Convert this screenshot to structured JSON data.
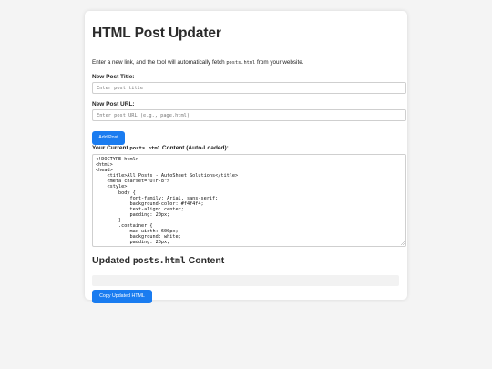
{
  "page": {
    "title": "HTML Post Updater",
    "intro_before": "Enter a new link, and the tool will automatically fetch ",
    "intro_code": "posts.html",
    "intro_after": " from your website."
  },
  "form": {
    "title_label": "New Post Title:",
    "title_placeholder": "Enter post title",
    "url_label": "New Post URL:",
    "url_placeholder": "Enter post URL (e.g., page.html)",
    "add_button": "Add Post"
  },
  "current": {
    "label_before": "Your Current ",
    "label_code": "posts.html",
    "label_after": " Content (Auto-Loaded):",
    "lines": [
      "<!DOCTYPE html>",
      "<html>",
      "<head>",
      "    <title>All Posts - AutoSheet Solutions</title>",
      "    <meta charset=\"UTF-8\">",
      "    <style>",
      "        body {",
      "            font-family: Arial, sans-serif;",
      "            background-color: #f4f4f4;",
      "            text-align: center;",
      "            padding: 20px;",
      "        }",
      "        .container {",
      "            max-width: 600px;",
      "            background: white;",
      "            padding: 20px;"
    ]
  },
  "updated": {
    "heading_before": "Updated ",
    "heading_code": "posts.html",
    "heading_after": " Content",
    "output_value": "",
    "copy_button": "Copy Updated HTML"
  },
  "colors": {
    "accent": "#1a7cf0",
    "background": "#f4f4f4"
  }
}
